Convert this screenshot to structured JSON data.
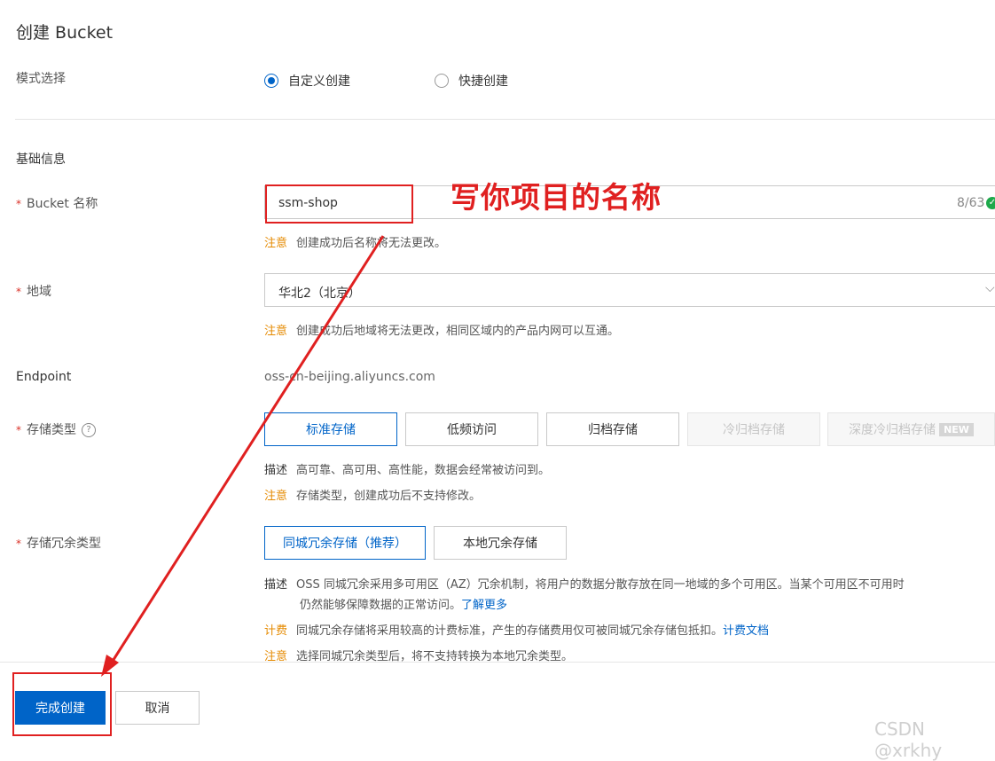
{
  "page": {
    "title": "创建 Bucket"
  },
  "mode": {
    "label": "模式选择",
    "options": [
      {
        "label": "自定义创建",
        "checked": true
      },
      {
        "label": "快捷创建",
        "checked": false
      }
    ]
  },
  "basic": {
    "section_title": "基础信息",
    "bucket_name": {
      "label": "Bucket 名称",
      "value": "ssm-shop",
      "counter": "8/63",
      "note_tag": "注意",
      "note_text": "创建成功后名称将无法更改。"
    },
    "region": {
      "label": "地域",
      "value": "华北2（北京）",
      "note_tag": "注意",
      "note_text": "创建成功后地域将无法更改，相同区域内的产品内网可以互通。"
    },
    "endpoint": {
      "label": "Endpoint",
      "value": "oss-cn-beijing.aliyuncs.com"
    },
    "storage_class": {
      "label": "存储类型",
      "help": "?",
      "options": [
        "标准存储",
        "低频访问",
        "归档存储",
        "冷归档存储",
        "深度冷归档存储"
      ],
      "new_tag": "NEW",
      "desc_tag": "描述",
      "desc_text": "高可靠、高可用、高性能，数据会经常被访问到。",
      "note_tag": "注意",
      "note_text": "存储类型，创建成功后不支持修改。"
    },
    "redundancy": {
      "label": "存储冗余类型",
      "options": [
        "同城冗余存储（推荐）",
        "本地冗余存储"
      ],
      "desc_tag": "描述",
      "desc_line1": "OSS 同城冗余采用多可用区（AZ）冗余机制，将用户的数据分散存放在同一地域的多个可用区。当某个可用区不可用时",
      "desc_line2": "仍然能够保障数据的正常访问。",
      "learn_more": "了解更多",
      "bill_tag": "计费",
      "bill_text": "同城冗余存储将采用较高的计费标准，产生的存储费用仅可被同城冗余存储包抵扣。",
      "bill_link": "计费文档",
      "note_tag": "注意",
      "note_text": "选择同城冗余类型后，将不支持转换为本地冗余类型。"
    }
  },
  "footer": {
    "submit": "完成创建",
    "cancel": "取消"
  },
  "annotation": {
    "text": "写你项目的名称"
  },
  "watermark": "CSDN @xrkhy",
  "colors": {
    "primary": "#0064c8",
    "warn": "#e58a00",
    "annotation": "#e02020",
    "success": "#1ea94b"
  }
}
